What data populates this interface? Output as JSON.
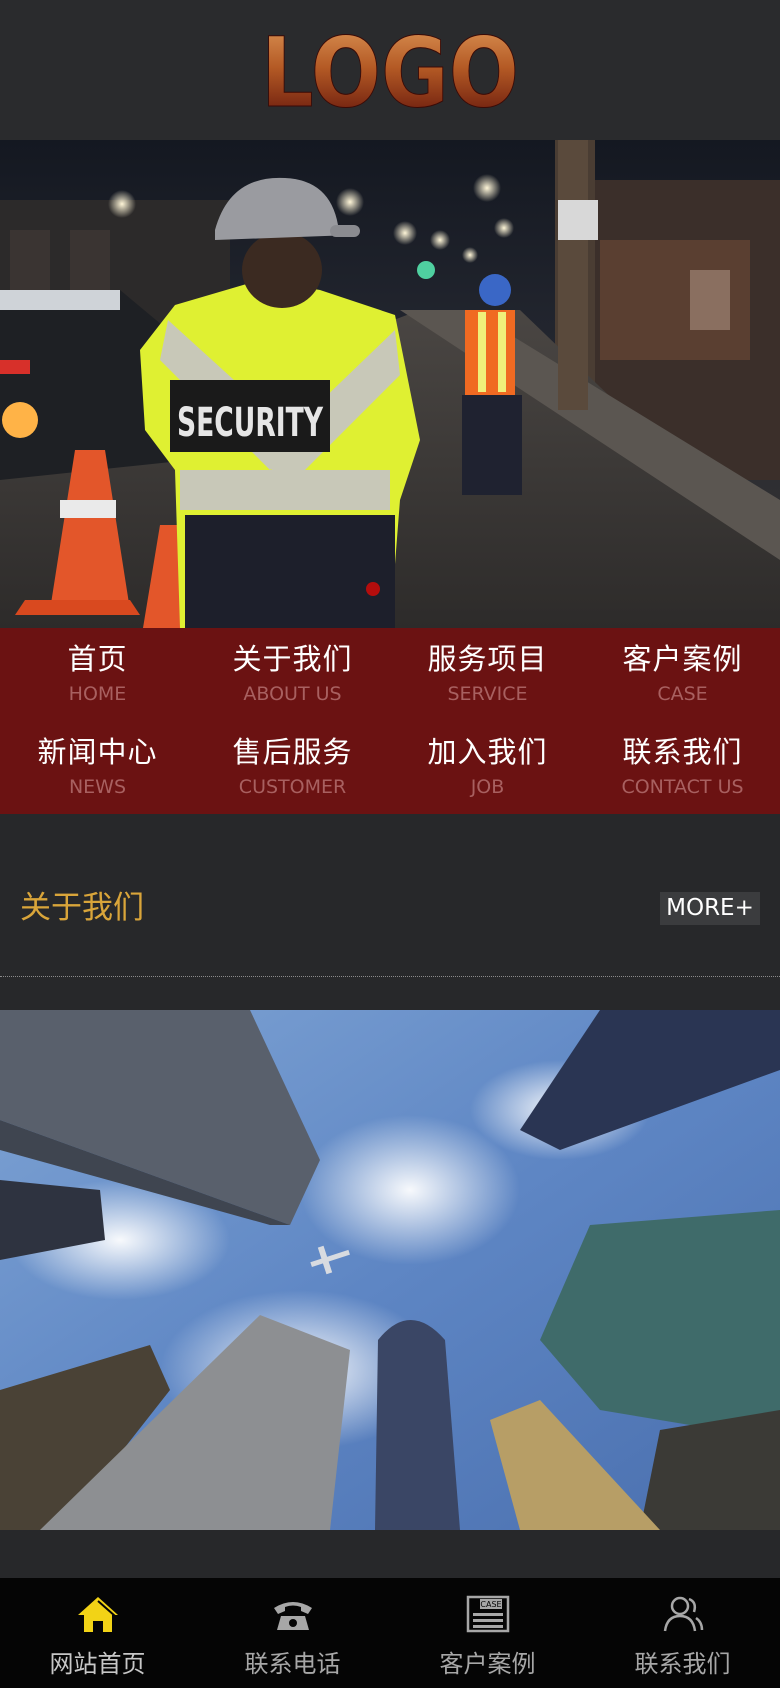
{
  "header": {
    "logo_text": "LOGO"
  },
  "banner": {
    "vest_text": "SECURITY"
  },
  "nav": {
    "items": [
      {
        "cn": "首页",
        "en": "HOME"
      },
      {
        "cn": "关于我们",
        "en": "ABOUT US"
      },
      {
        "cn": "服务项目",
        "en": "SERVICE"
      },
      {
        "cn": "客户案例",
        "en": "CASE"
      },
      {
        "cn": "新闻中心",
        "en": "NEWS"
      },
      {
        "cn": "售后服务",
        "en": "CUSTOMER"
      },
      {
        "cn": "加入我们",
        "en": "JOB"
      },
      {
        "cn": "联系我们",
        "en": "CONTACT US"
      }
    ]
  },
  "about": {
    "title": "关于我们",
    "more_label": "MORE+"
  },
  "tabbar": {
    "items": [
      {
        "label": "网站首页",
        "icon": "home-icon"
      },
      {
        "label": "联系电话",
        "icon": "phone-icon"
      },
      {
        "label": "客户案例",
        "icon": "case-icon"
      },
      {
        "label": "联系我们",
        "icon": "contact-icon"
      }
    ],
    "case_icon_text": "CASE"
  },
  "colors": {
    "background": "#27282a",
    "nav_background": "#6b1212",
    "accent_title": "#d9a53a",
    "tab_active_icon": "#f2d316"
  }
}
